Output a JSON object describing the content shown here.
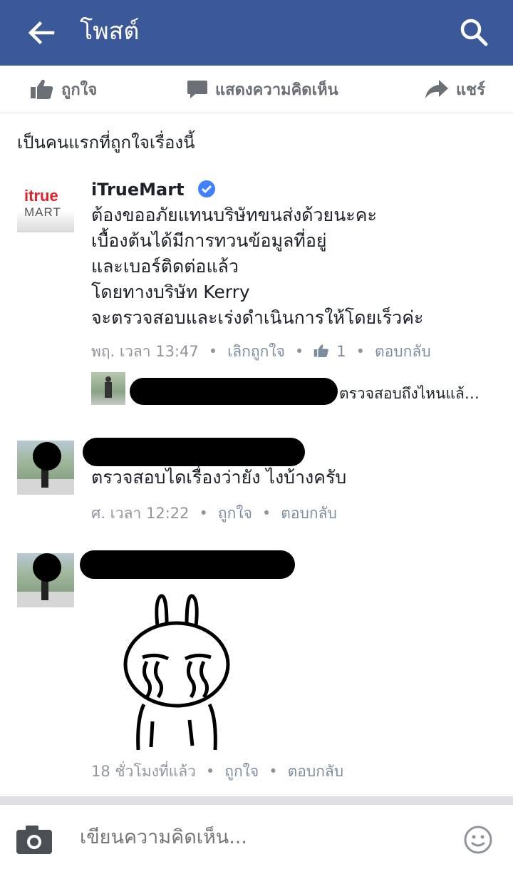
{
  "header": {
    "title": "โพสต์"
  },
  "actions": {
    "like": "ถูกใจ",
    "comment": "แสดงความคิดเห็น",
    "share": "แชร์"
  },
  "likes_summary": "เป็นคนแรกที่ถูกใจเรื่องนี้",
  "comments": [
    {
      "author": "iTrueMart",
      "avatar_text_top": "true",
      "avatar_text_bottom": "MART",
      "lines": [
        "ต้องขออภัยแทนบริษัทขนส่งด้วยนะคะ",
        "เบื้องต้นได้มีการทวนข้อมูลที่อยู่",
        "และเบอร์ติดต่อแล้ว",
        "โดยทางบริษัท Kerry",
        "จะตรวจสอบและเร่งดำเนินการให้โดยเร็วค่ะ"
      ],
      "time": "พฤ. เวลา 13:47",
      "like_action": "เลิกถูกใจ",
      "like_count": "1",
      "reply_action": "ตอบกลับ",
      "reply_preview": "ตรวจสอบถึงไหนแล้…"
    },
    {
      "text": "ตรวจสอบไดเรื่องว่ายัง ไงบ้างครับ",
      "time": "ศ. เวลา 12:22",
      "like_action": "ถูกใจ",
      "reply_action": "ตอบกลับ"
    },
    {
      "time": "18 ชั่วโมงที่แล้ว",
      "like_action": "ถูกใจ",
      "reply_action": "ตอบกลับ"
    }
  ],
  "composer": {
    "placeholder": "เขียนความคิดเห็น..."
  },
  "colors": {
    "header_bg": "#3b5998",
    "verified": "#4080ff",
    "brand_red": "#e4202b"
  }
}
